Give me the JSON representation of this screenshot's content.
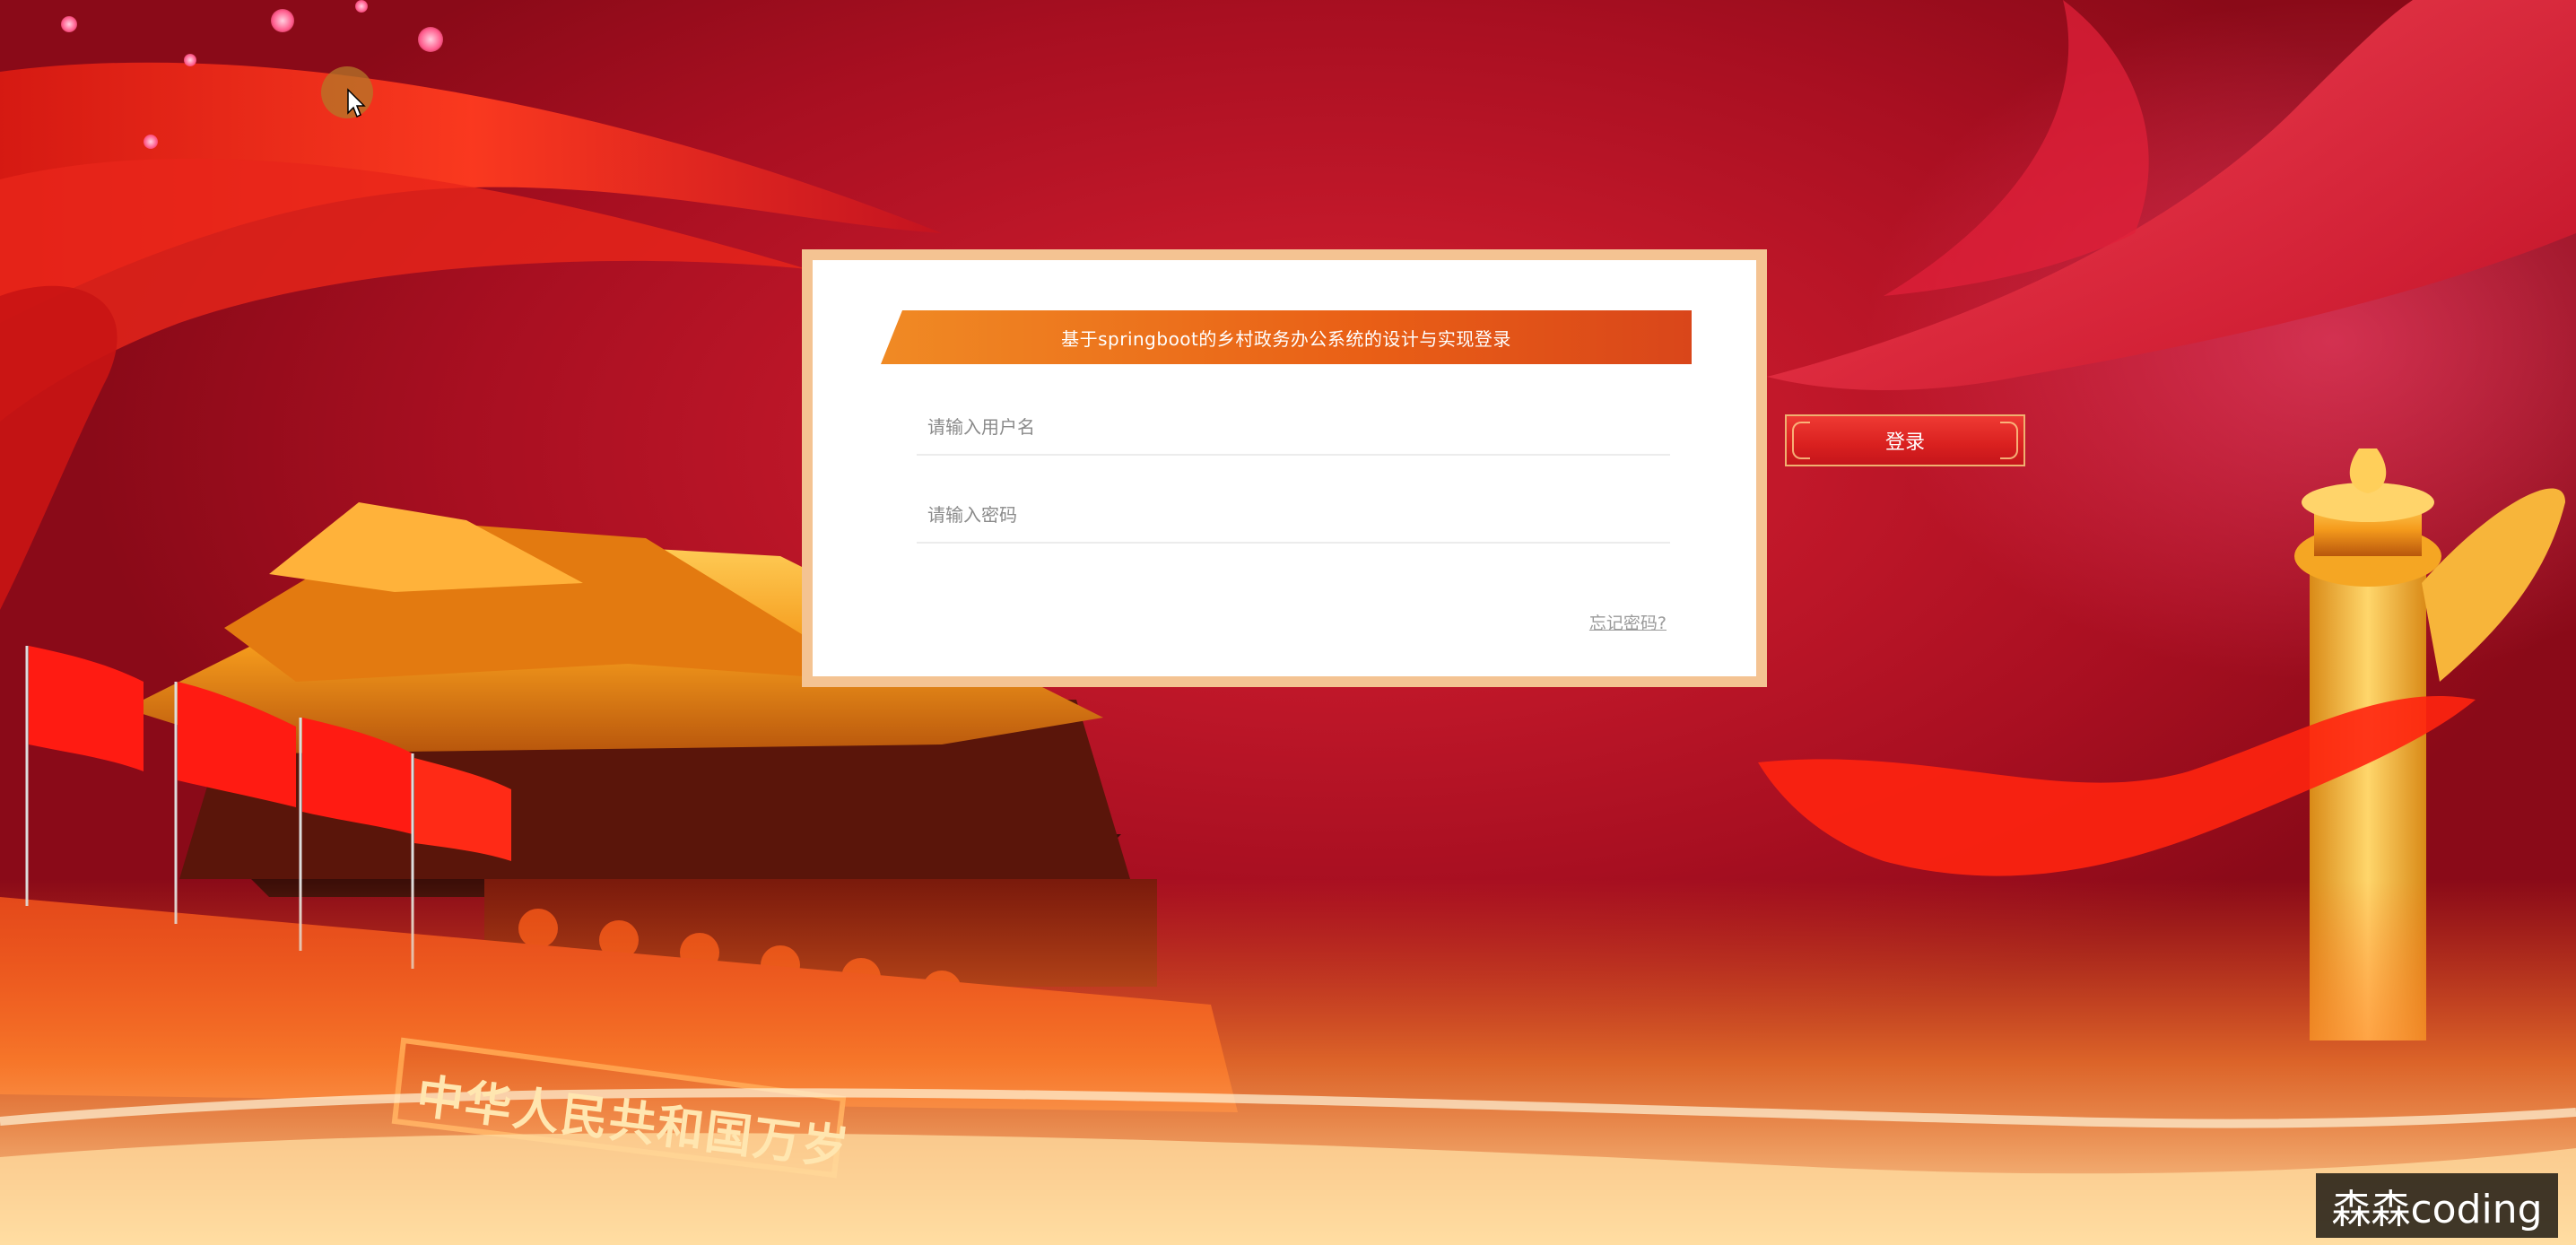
{
  "login_panel": {
    "title": "基于springboot的乡村政务办公系统的设计与实现登录",
    "username_placeholder": "请输入用户名",
    "password_placeholder": "请输入密码",
    "forgot_password": "忘记密码?"
  },
  "login_button": {
    "label": "登录"
  },
  "background": {
    "gate_plaque_text": "中华人民共和国万岁"
  },
  "watermark": {
    "text": "森森coding"
  },
  "colors": {
    "background_red": "#c2182a",
    "banner_orange": "#ea6a1a",
    "card_border": "#f4c392",
    "button_red": "#d9201f"
  }
}
